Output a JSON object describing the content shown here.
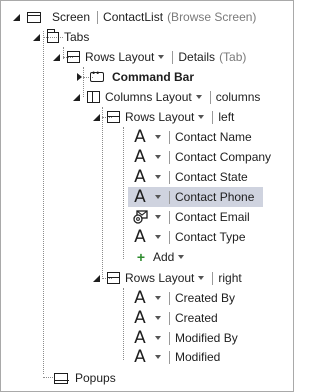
{
  "tree": {
    "screen": {
      "label": "Screen",
      "name": "ContactList",
      "type": "(Browse Screen)"
    },
    "tabs": {
      "label": "Tabs"
    },
    "rows_layout_details": {
      "label": "Rows Layout",
      "name": "Details",
      "type": "(Tab)"
    },
    "command_bar": {
      "label": "Command Bar"
    },
    "columns_layout": {
      "label": "Columns Layout",
      "name": "columns"
    },
    "rows_layout_left": {
      "label": "Rows Layout",
      "name": "left"
    },
    "left_fields": [
      {
        "label": "Contact Name",
        "icon": "text-A-icon"
      },
      {
        "label": "Contact Company",
        "icon": "text-A-icon"
      },
      {
        "label": "Contact State",
        "icon": "text-A-icon"
      },
      {
        "label": "Contact Phone",
        "icon": "text-A-icon",
        "selected": true
      },
      {
        "label": "Contact Email",
        "icon": "email-icon"
      },
      {
        "label": "Contact Type",
        "icon": "text-A-icon"
      }
    ],
    "add": {
      "label": "Add"
    },
    "rows_layout_right": {
      "label": "Rows Layout",
      "name": "right"
    },
    "right_fields": [
      {
        "label": "Created By"
      },
      {
        "label": "Created"
      },
      {
        "label": "Modified By"
      },
      {
        "label": "Modified"
      }
    ],
    "popups": {
      "label": "Popups"
    }
  },
  "colors": {
    "selection": "#cfd3df",
    "add_plus": "#2e8b2e",
    "muted_text": "#7a7a7a"
  }
}
